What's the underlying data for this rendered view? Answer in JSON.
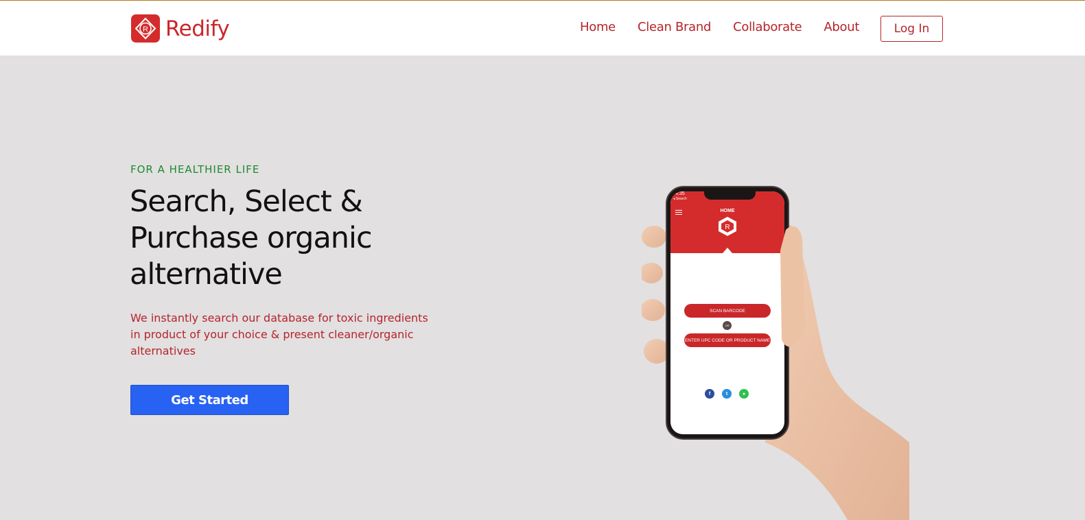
{
  "brand": {
    "name": "Redify",
    "logo_icon": "redify-logo-icon",
    "logo_letter": "R"
  },
  "nav": {
    "items": [
      {
        "label": "Home"
      },
      {
        "label": "Clean Brand"
      },
      {
        "label": "Collaborate"
      },
      {
        "label": "About"
      }
    ],
    "login_label": "Log In"
  },
  "hero": {
    "eyebrow": "FOR A HEALTHIER LIFE",
    "headline": "Search, Select & Purchase organic alternative",
    "subtext": "We instantly search our database for toxic ingredients in product of your choice & present cleaner/organic alternatives",
    "cta_label": "Get Started"
  },
  "phone_mockup": {
    "status_time": "4:35",
    "back_label": "◂ Search",
    "screen_title": "HOME",
    "scan_label": "SCAN BARCODE",
    "or_label": "OR",
    "upc_label": "ENTER UPC CODE OR PRODUCT NAME",
    "share_icons": [
      "facebook-icon",
      "twitter-icon",
      "message-icon"
    ]
  },
  "colors": {
    "brand_red": "#c9272a",
    "eyebrow_green": "#1d8a2e",
    "cta_blue": "#2762f2",
    "hero_bg": "#e2e0e1"
  }
}
